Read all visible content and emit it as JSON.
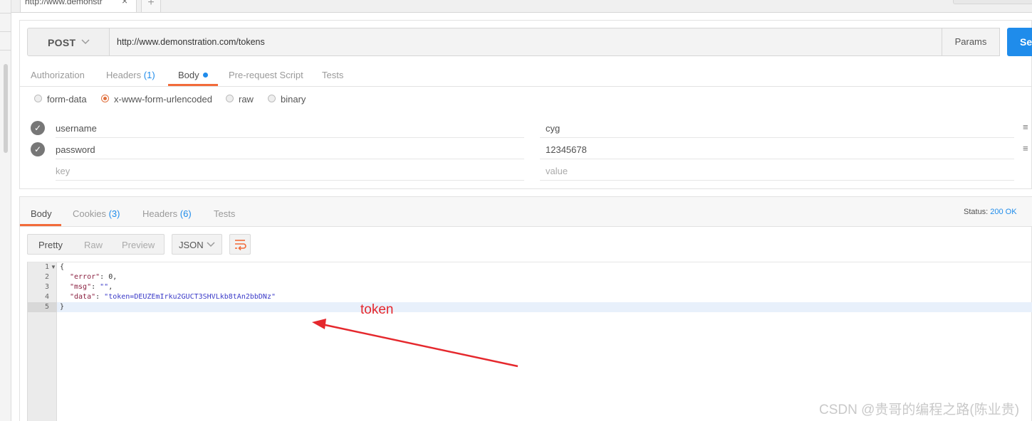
{
  "browser_tab": {
    "title": "http://www.demonstr",
    "close": "×",
    "new_tab": "+"
  },
  "request": {
    "method": "POST",
    "url": "http://www.demonstration.com/tokens",
    "params_label": "Params",
    "send_label": "Send",
    "tabs": [
      {
        "label": "Authorization"
      },
      {
        "label": "Headers",
        "count": "(1)"
      },
      {
        "label": "Body"
      },
      {
        "label": "Pre-request Script"
      },
      {
        "label": "Tests"
      }
    ],
    "body_types": [
      "form-data",
      "x-www-form-urlencoded",
      "raw",
      "binary"
    ],
    "selected_body_type": "x-www-form-urlencoded",
    "rows": [
      {
        "key": "username",
        "value": "cyg"
      },
      {
        "key": "password",
        "value": "12345678"
      }
    ],
    "placeholder_key": "key",
    "placeholder_value": "value"
  },
  "response": {
    "tabs": [
      {
        "label": "Body"
      },
      {
        "label": "Cookies",
        "count": "(3)"
      },
      {
        "label": "Headers",
        "count": "(6)"
      },
      {
        "label": "Tests"
      }
    ],
    "status_label": "Status:",
    "status_value": "200 OK",
    "formats": [
      "Pretty",
      "Raw",
      "Preview"
    ],
    "language": "JSON",
    "code": {
      "line_numbers": [
        "1",
        "2",
        "3",
        "4",
        "5"
      ],
      "open_brace": "{",
      "close_brace": "}",
      "fields": [
        {
          "key": "\"error\"",
          "value": "0",
          "trail": ","
        },
        {
          "key": "\"msg\"",
          "value": "\"\"",
          "trail": ","
        },
        {
          "key": "\"data\"",
          "value": "\"token=DEUZEmIrku2GUCT3SHVLkb8tAn2bbDNz\"",
          "trail": ""
        }
      ]
    }
  },
  "annotation": {
    "text": "token",
    "color": "#e5282d"
  },
  "watermark": "CSDN @贵哥的编程之路(陈业贵)",
  "colors": {
    "accent": "#f26b3a",
    "primary": "#1f8ceb"
  }
}
